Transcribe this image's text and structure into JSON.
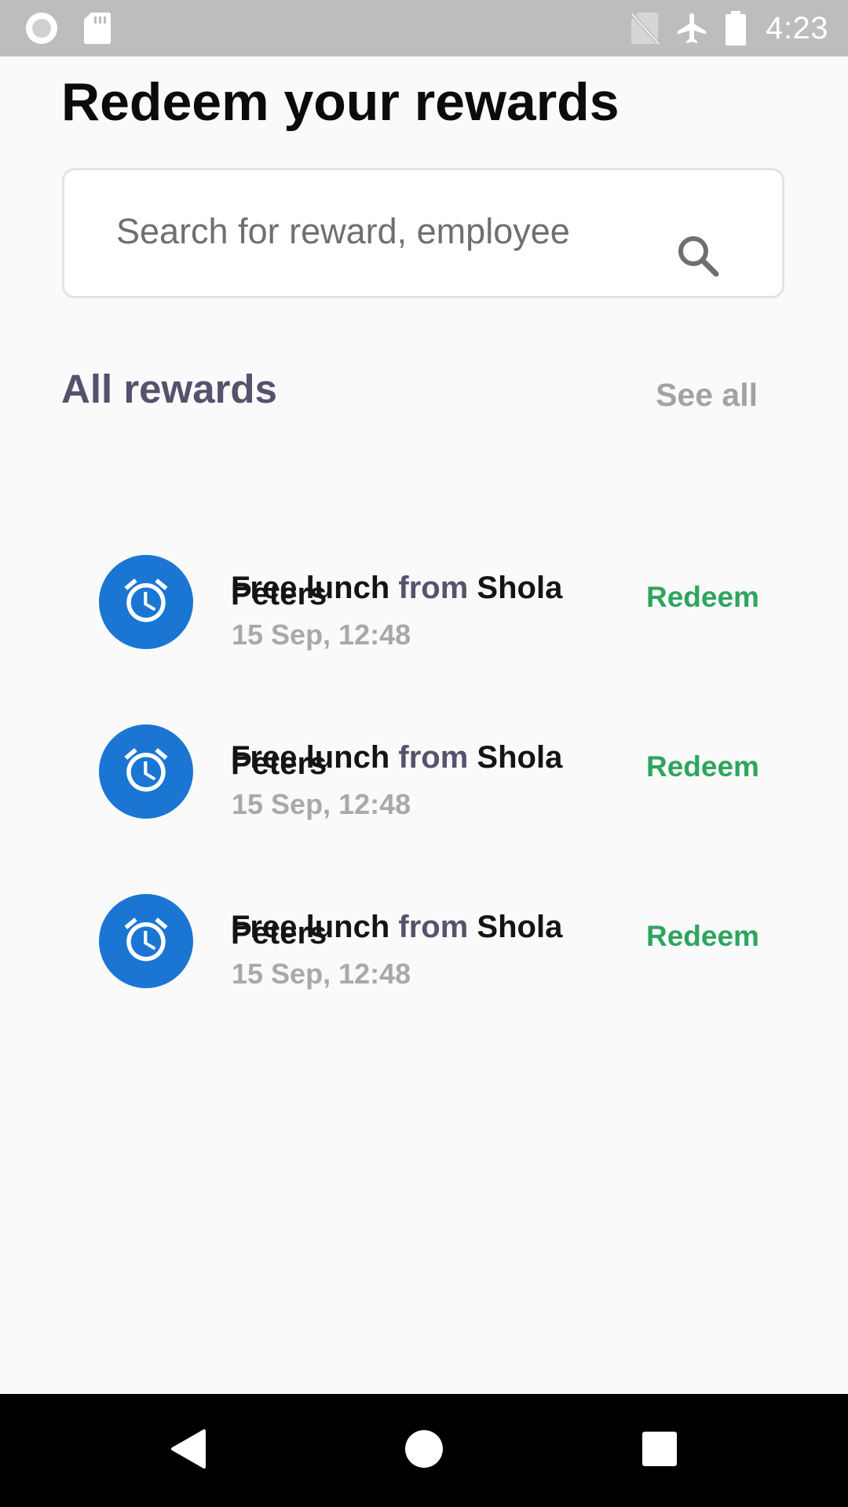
{
  "status_bar": {
    "time": "4:23",
    "icons": [
      "record-icon",
      "sd-card-icon",
      "no-sim-icon",
      "airplane-mode-icon",
      "battery-icon"
    ]
  },
  "page": {
    "title": "Redeem your rewards"
  },
  "search": {
    "placeholder": "Search for reward, employee",
    "icon": "search-icon"
  },
  "section": {
    "title": "All rewards",
    "see_all_label": "See all"
  },
  "rewards": [
    {
      "item": "Free lunch",
      "from_word": "from",
      "giver": "Shola",
      "giver_overflow": "Peters",
      "date": "15 Sep, 12:48",
      "action_label": "Redeem",
      "icon": "alarm-clock-icon"
    },
    {
      "item": "Free lunch",
      "from_word": "from",
      "giver": "Shola",
      "giver_overflow": "Peters",
      "date": "15 Sep, 12:48",
      "action_label": "Redeem",
      "icon": "alarm-clock-icon"
    },
    {
      "item": "Free lunch",
      "from_word": "from",
      "giver": "Shola",
      "giver_overflow": "Peters",
      "date": "15 Sep, 12:48",
      "action_label": "Redeem",
      "icon": "alarm-clock-icon"
    }
  ],
  "nav_bar": {
    "buttons": [
      "back-icon",
      "home-icon",
      "recents-icon"
    ]
  },
  "colors": {
    "status_bar": "#bdbdbd",
    "avatar_blue": "#1b76d3",
    "redeem_green": "#2ea55e",
    "section_title": "#54526d",
    "muted_gray": "#a3a3a3"
  }
}
